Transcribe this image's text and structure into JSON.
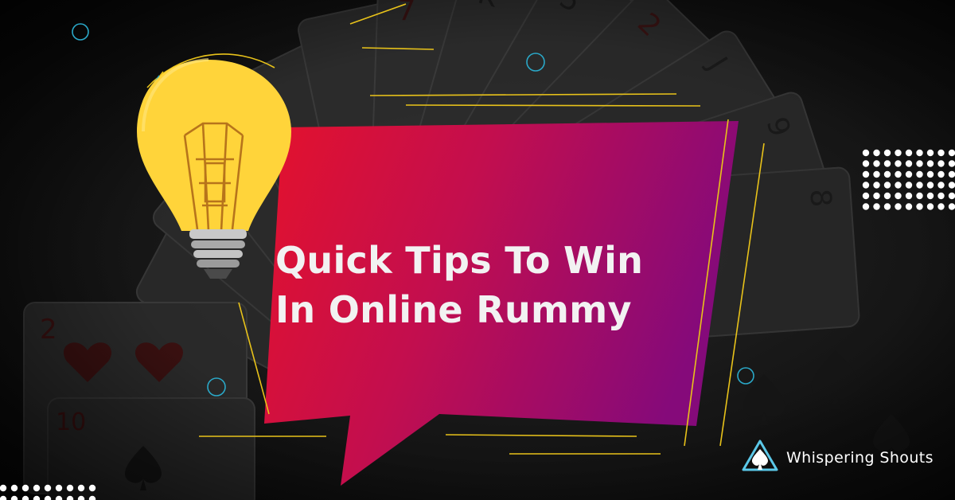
{
  "banner": {
    "headline_line1": "Quick Tips To Win",
    "headline_line2": "In Online Rummy",
    "brand_name": "Whispering Shouts"
  },
  "colors": {
    "background": "#141414",
    "bubble_start": "#e0102e",
    "bubble_end": "#8a0a78",
    "bulb": "#ffd43a",
    "accent_lines": "#e8c21a",
    "rings": "#2aa8c8",
    "headline": "#f2f2f2",
    "dots": "#ffffff",
    "logo_icon": "#5bc8e8"
  },
  "icons": [
    "light-bulb-icon",
    "spade-logo-icon",
    "playing-card-icon"
  ]
}
